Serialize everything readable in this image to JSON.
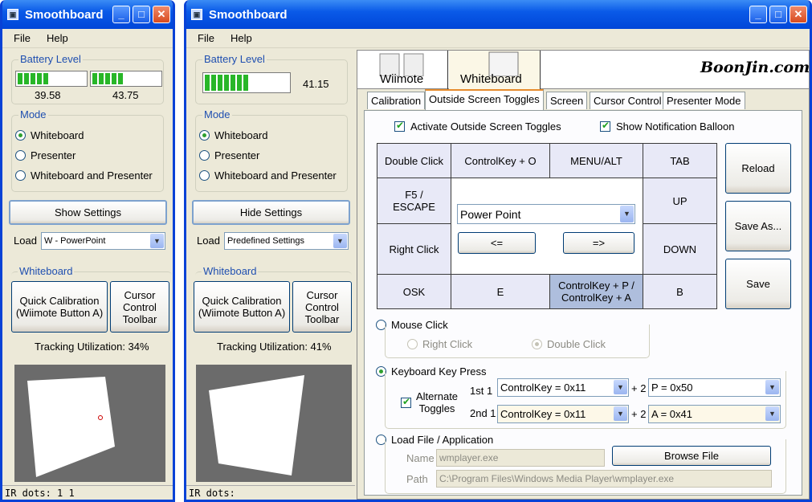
{
  "left_window": {
    "title": "Smoothboard",
    "menu": [
      "File",
      "Help"
    ],
    "battery_label": "Battery Level",
    "battery1": {
      "value": "39.58",
      "level": 0.4
    },
    "battery2": {
      "value": "43.75",
      "level": 0.44
    },
    "mode_label": "Mode",
    "modes": [
      "Whiteboard",
      "Presenter",
      "Whiteboard and Presenter"
    ],
    "selected_mode": "Whiteboard",
    "settings_button": "Show Settings",
    "load_label": "Load",
    "load_value": "W - PowerPoint",
    "whiteboard_label": "Whiteboard",
    "quick_cal_line1": "Quick Calibration",
    "quick_cal_line2": "(Wiimote Button A)",
    "cursor_line1": "Cursor",
    "cursor_line2": "Control",
    "cursor_line3": "Toolbar",
    "tracking": "Tracking Utilization:  34%",
    "status": "IR dots: 1        1"
  },
  "right_window": {
    "title": "Smoothboard",
    "menu": [
      "File",
      "Help"
    ],
    "battery_label": "Battery Level",
    "battery": {
      "value": "41.15",
      "level": 0.41
    },
    "mode_label": "Mode",
    "modes": [
      "Whiteboard",
      "Presenter",
      "Whiteboard and Presenter"
    ],
    "selected_mode": "Whiteboard",
    "settings_button": "Hide Settings",
    "load_label": "Load",
    "load_value": "Predefined Settings",
    "whiteboard_label": "Whiteboard",
    "quick_cal_line1": "Quick Calibration",
    "quick_cal_line2": "(Wiimote Button A)",
    "cursor_line1": "Cursor",
    "cursor_line2": "Control",
    "cursor_line3": "Toolbar",
    "tracking": "Tracking Utilization:  41%",
    "status": "IR dots:",
    "header": {
      "wiimote": "Wiimote",
      "whiteboard": "Whiteboard",
      "logo": "BoonJin.com"
    },
    "tabs": [
      "Calibration",
      "Outside Screen Toggles",
      "Screen",
      "Cursor Control",
      "Presenter Mode"
    ],
    "active_tab": "Outside Screen Toggles",
    "activate_toggles": "Activate Outside Screen Toggles",
    "show_balloon": "Show Notification Balloon",
    "grid": {
      "double_click": "Double Click",
      "ctrl_o": "ControlKey + O",
      "menu_alt": "MENU/ALT",
      "tab": "TAB",
      "f5_line1": "F5  /",
      "f5_line2": "ESCAPE",
      "up": "UP",
      "right_click": "Right Click",
      "down": "DOWN",
      "osk": "OSK",
      "e": "E",
      "ctrl_p_line1": "ControlKey + P  /",
      "ctrl_p_line2": "ControlKey + A",
      "b": "B",
      "profile": "Power Point",
      "prev": "<=",
      "next": "=>"
    },
    "side_buttons": {
      "reload": "Reload",
      "save_as": "Save As...",
      "save": "Save"
    },
    "mouse_click": {
      "label": "Mouse Click",
      "right": "Right Click",
      "double": "Double Click"
    },
    "keyboard": {
      "label": "Keyboard Key Press",
      "alternate_line1": "Alternate",
      "alternate_line2": "Toggles",
      "first_label": "1st 1",
      "second_label": "2nd 1",
      "plus": "+ 2",
      "first_key1": "ControlKey =  0x11",
      "first_key2": "P =  0x50",
      "second_key1": "ControlKey =  0x11",
      "second_key2": "A =  0x41"
    },
    "load_file": {
      "label": "Load File / Application",
      "name_label": "Name",
      "name_value": "wmplayer.exe",
      "browse": "Browse File",
      "path_label": "Path",
      "path_value": "C:\\Program Files\\Windows Media Player\\wmplayer.exe"
    }
  },
  "colors": {
    "titlebar": "#0a5ae8",
    "group_label": "#1f4fb0",
    "battery": "#28b628",
    "grid_dark": "#aebedd",
    "grid_light": "#e8e9f7",
    "tab_highlight": "#e68b2c"
  }
}
